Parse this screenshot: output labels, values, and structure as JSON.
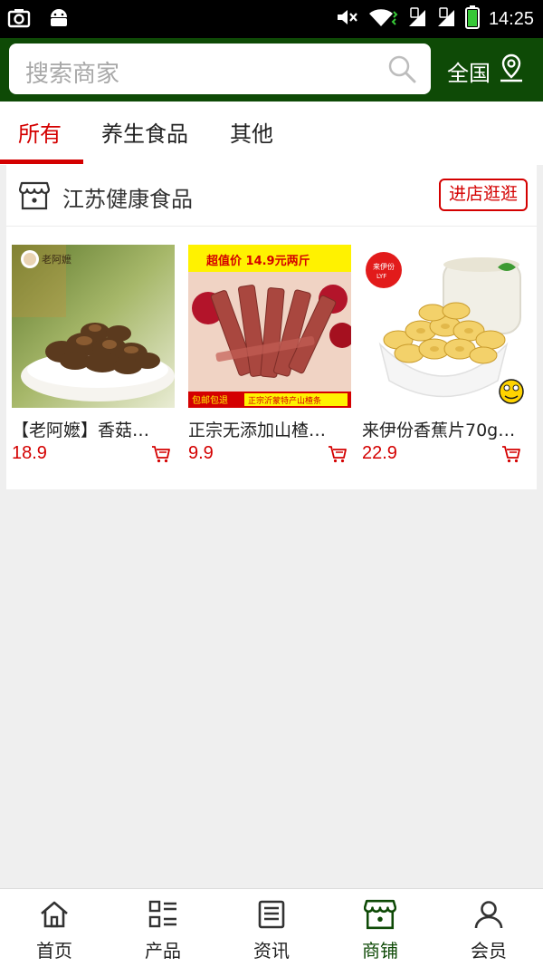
{
  "status_bar": {
    "time": "14:25"
  },
  "header": {
    "search_placeholder": "搜索商家",
    "region_label": "全国"
  },
  "tabs": [
    {
      "label": "所有",
      "active": true
    },
    {
      "label": "养生食品",
      "active": false
    },
    {
      "label": "其他",
      "active": false
    }
  ],
  "store": {
    "name": "江苏健康食品",
    "enter_button": "进店逛逛",
    "products": [
      {
        "title": "【老阿嬷】香菇…",
        "price": "18.9",
        "image_text": [
          "老阿嬷"
        ]
      },
      {
        "title": "正宗无添加山楂…",
        "price": "9.9",
        "image_text": [
          "超值价  14.9元两斤",
          "包邮包退",
          "正宗沂蒙特产山楂条"
        ]
      },
      {
        "title": "来伊份香蕉片70g…",
        "price": "22.9",
        "image_text": [
          "来伊份",
          "LYF"
        ]
      }
    ]
  },
  "bottom_nav": [
    {
      "label": "首页",
      "icon": "home-icon",
      "active": false
    },
    {
      "label": "产品",
      "icon": "product-list-icon",
      "active": false
    },
    {
      "label": "资讯",
      "icon": "news-icon",
      "active": false
    },
    {
      "label": "商铺",
      "icon": "shop-icon",
      "active": true
    },
    {
      "label": "会员",
      "icon": "member-icon",
      "active": false
    }
  ],
  "colors": {
    "brand_green": "#0e4a06",
    "accent_red": "#d40000"
  }
}
